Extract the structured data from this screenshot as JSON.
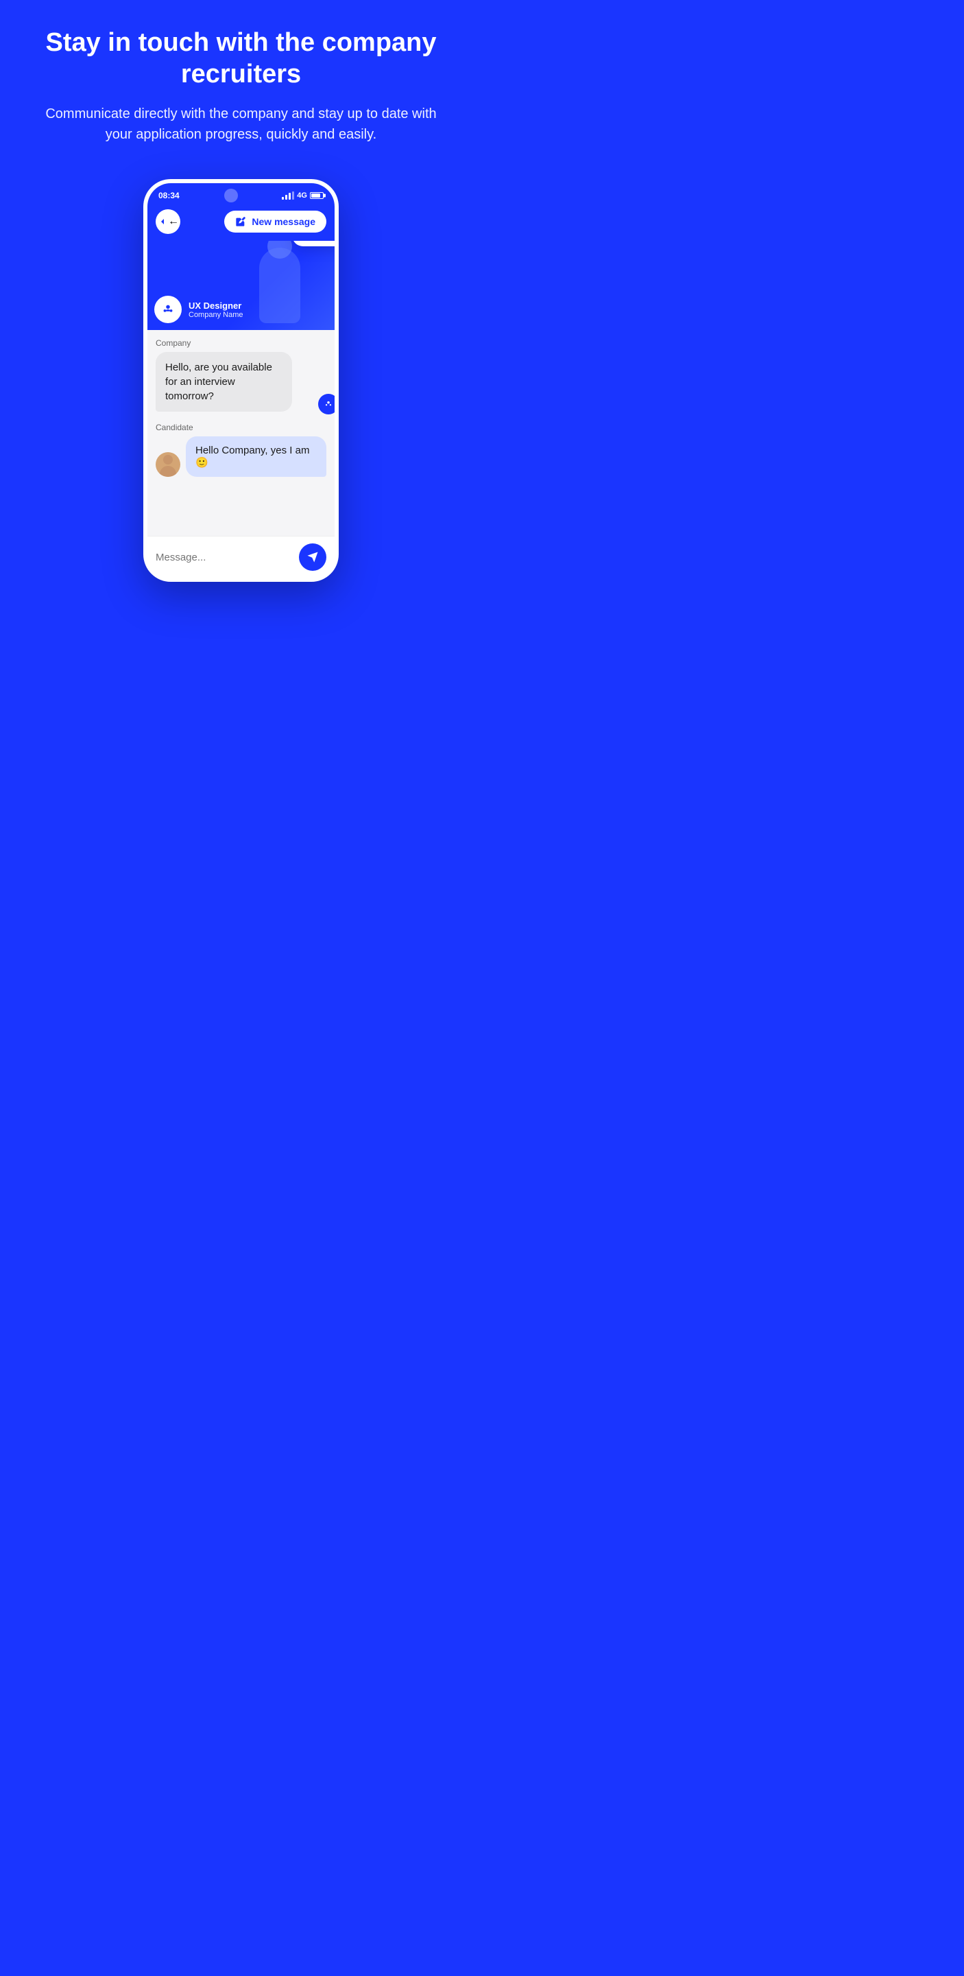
{
  "page": {
    "background_color": "#1a35ff"
  },
  "hero": {
    "title": "Stay in touch with the company recruiters",
    "subtitle": "Communicate directly with the company and stay up to date with your application progress, quickly and easily."
  },
  "phone": {
    "status_bar": {
      "time": "08:34",
      "network": "4G"
    },
    "nav": {
      "back_label": "back",
      "new_message_label": "New message"
    },
    "job_card": {
      "title": "UX Designer",
      "company": "Company Name"
    },
    "chat": {
      "company_sender": "Company",
      "company_message": "Hello, are you available for an interview tomorrow?",
      "candidate_sender": "Candidate",
      "candidate_message": "Hello Company, yes I am 🙂"
    },
    "input": {
      "placeholder": "Message..."
    }
  }
}
